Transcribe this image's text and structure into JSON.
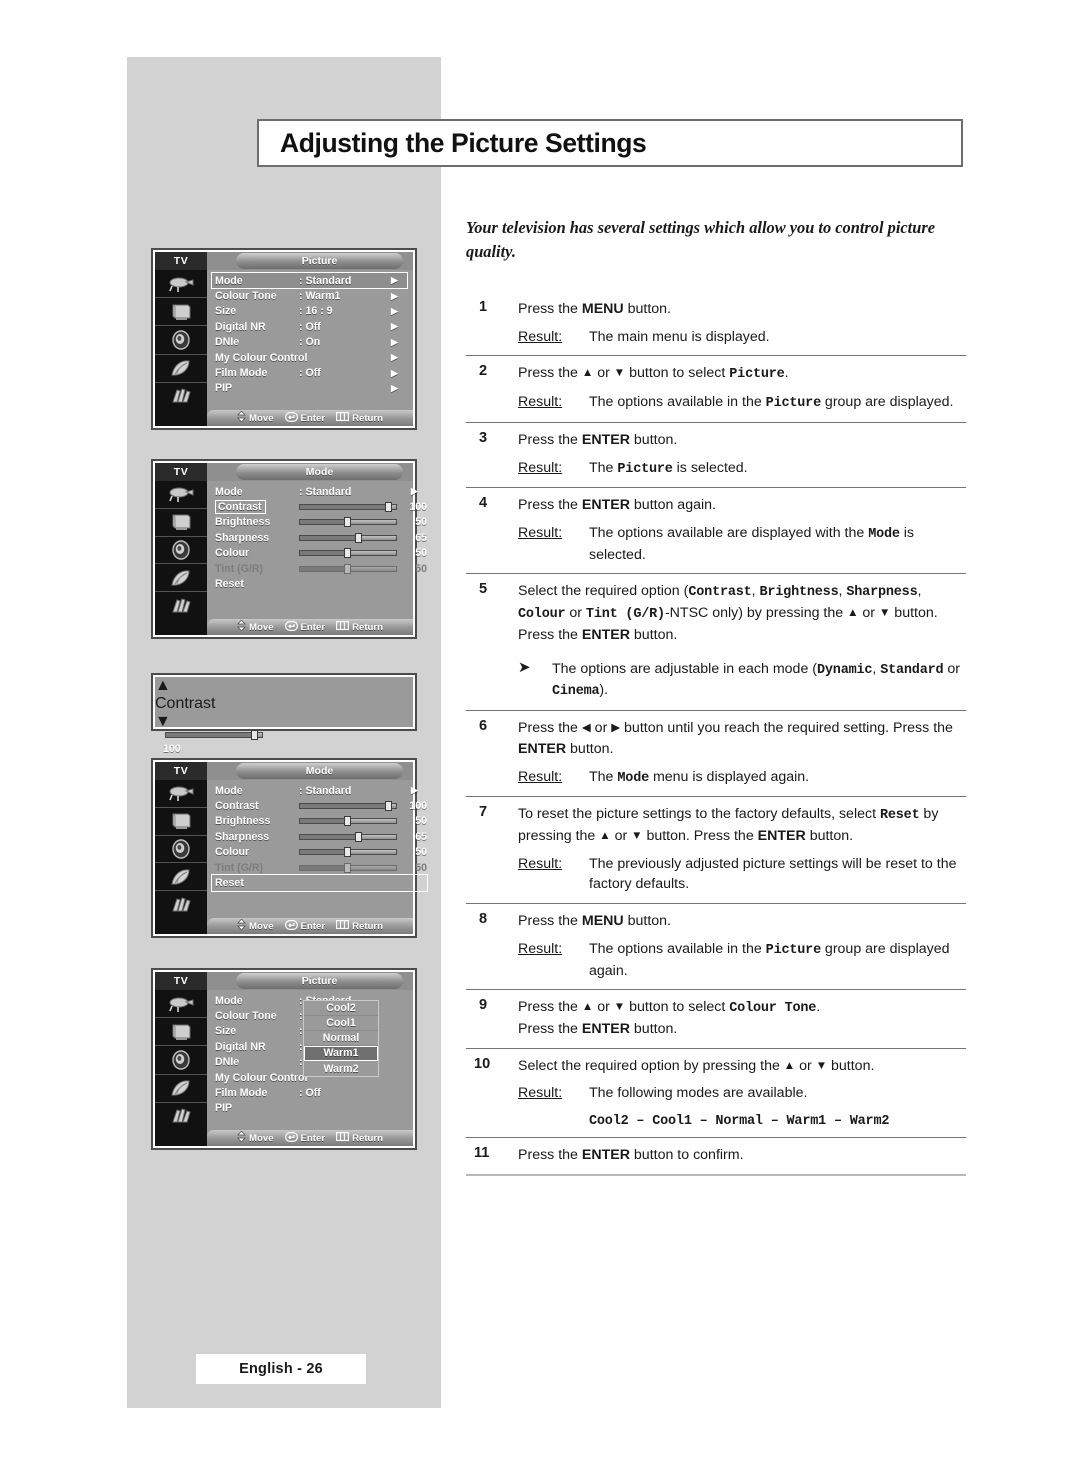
{
  "page": {
    "title": "Adjusting the Picture Settings",
    "intro": "Your television has several settings which allow you to control picture quality.",
    "footer": "English - 26"
  },
  "steps": [
    {
      "num": "1",
      "text_html": "Press the <b>MENU</b> button.",
      "result_label": "Result:",
      "result_html": "The main menu is displayed."
    },
    {
      "num": "2",
      "text_html": "Press the <span class=\"arrw\">▲</span> or <span class=\"arrw\">▼</span> button to select <span class=\"mono\">Picture</span>.",
      "result_label": "Result:",
      "result_html": "The options available in the <span class=\"mono\">Picture</span> group are displayed."
    },
    {
      "num": "3",
      "text_html": "Press the <b>ENTER</b> button.",
      "result_label": "Result:",
      "result_html": "The <span class=\"mono\">Picture</span> is selected."
    },
    {
      "num": "4",
      "text_html": "Press the <b>ENTER</b> button again.",
      "result_label": "Result:",
      "result_html": "The options available are displayed with the <span class=\"mono\">Mode</span> is selected."
    },
    {
      "num": "5",
      "text_html": "Select the required option (<span class=\"mono\">Contrast</span>, <span class=\"mono\">Brightness</span>, <span class=\"mono\">Sharpness</span>, <span class=\"mono\">Colour</span> or <span class=\"mono\">Tint&nbsp;(G/R)</span>-NTSC only) by pressing the <span class=\"arrw\">▲</span> or <span class=\"arrw\">▼</span> button.&nbsp; Press the <b>ENTER</b> button.",
      "bullet_html": "The options are adjustable in each mode (<span class=\"mono\">Dynamic</span>, <span class=\"mono\">Standard</span> or <span class=\"mono\">Cinema</span>)."
    },
    {
      "num": "6",
      "text_html": "Press the <span class=\"arrw\">◀</span> or <span class=\"arrw\">▶</span> button until you reach the required setting. Press the <b>ENTER</b> button.",
      "result_label": "Result:",
      "result_html": "The <span class=\"mono\">Mode</span> menu is displayed again."
    },
    {
      "num": "7",
      "text_html": "To reset the picture settings to the factory defaults, select <span class=\"mono\">Reset</span> by pressing the <span class=\"arrw\">▲</span> or <span class=\"arrw\">▼</span> button. Press the <b>ENTER</b> button.",
      "result_label": "Result:",
      "result_html": "The previously adjusted picture settings will be reset to the factory defaults."
    },
    {
      "num": "8",
      "text_html": "Press the <b>MENU</b> button.",
      "result_label": "Result:",
      "result_html": "The options available in the <span class=\"mono\">Picture</span> group are displayed again."
    },
    {
      "num": "9",
      "text_html": "Press the <span class=\"arrw\">▲</span> or <span class=\"arrw\">▼</span> button to select <span class=\"mono\">Colour&nbsp;Tone</span>.<br>Press the <b>ENTER</b> button."
    },
    {
      "num": "10",
      "text_html": "Select the required option by pressing the <span class=\"arrw\">▲</span> or <span class=\"arrw\">▼</span> button.",
      "result_label": "Result:",
      "result_html": "The following modes are available.",
      "modes_html": "<span class=\"mono\">Cool2&nbsp;&ndash;&nbsp;Cool1&nbsp;&ndash;&nbsp;Normal&nbsp;&ndash;&nbsp;Warm1&nbsp;&ndash;&nbsp;Warm2</span>"
    },
    {
      "num": "11",
      "text_html": "Press the <b>ENTER</b> button to confirm."
    }
  ],
  "osd_common": {
    "tv_tag": "TV",
    "bottom_bar": [
      {
        "icon": "move-updown-icon",
        "label": "Move"
      },
      {
        "icon": "enter-key-icon",
        "label": "Enter"
      },
      {
        "icon": "return-menu-icon",
        "label": "Return"
      }
    ],
    "side_icons": [
      "antenna-icon",
      "tv-set-icon",
      "speaker-icon",
      "feather-icon",
      "hand-icon"
    ]
  },
  "osd_picture_1": {
    "title": "Picture",
    "rows": [
      {
        "label": "Mode",
        "value": ": Standard",
        "caret": "▶",
        "selected": true
      },
      {
        "label": "Colour Tone",
        "value": ": Warm1",
        "caret": "▶"
      },
      {
        "label": "Size",
        "value": ": 16 : 9",
        "caret": "▶"
      },
      {
        "label": "Digital NR",
        "value": ": Off",
        "caret": "▶"
      },
      {
        "label": "DNIe",
        "value": ": On",
        "caret": "▶"
      },
      {
        "label": "My Colour Control",
        "value": "",
        "caret": "▶"
      },
      {
        "label": "Film Mode",
        "value": ": Off",
        "caret": "▶"
      },
      {
        "label": "PIP",
        "value": "",
        "caret": "▶"
      }
    ]
  },
  "osd_mode_1": {
    "title": "Mode",
    "mode_row": {
      "label": "Mode",
      "value": ": Standard",
      "caret": "▶"
    },
    "sliders": [
      {
        "label": "Contrast",
        "value": "100",
        "pct": 96,
        "boxed_label": true
      },
      {
        "label": "Brightness",
        "value": "50",
        "pct": 50
      },
      {
        "label": "Sharpness",
        "value": "65",
        "pct": 62
      },
      {
        "label": "Colour",
        "value": "50",
        "pct": 50
      },
      {
        "label": "Tint (G/R)",
        "value": "50",
        "pct": 50,
        "dim": true
      }
    ],
    "reset_label": "Reset",
    "reset_selected": false
  },
  "osd_contrast_widget": {
    "label": "Contrast",
    "value": "100",
    "pct": 96,
    "up_arrow": "▲",
    "down_arrow": "▼"
  },
  "osd_mode_2": {
    "title": "Mode",
    "mode_row": {
      "label": "Mode",
      "value": ": Standard",
      "caret": "▶"
    },
    "sliders": [
      {
        "label": "Contrast",
        "value": "100",
        "pct": 96
      },
      {
        "label": "Brightness",
        "value": "50",
        "pct": 50
      },
      {
        "label": "Sharpness",
        "value": "65",
        "pct": 62
      },
      {
        "label": "Colour",
        "value": "50",
        "pct": 50
      },
      {
        "label": "Tint (G/R)",
        "value": "50",
        "pct": 50,
        "dim": true
      }
    ],
    "reset_label": "Reset",
    "reset_selected": true
  },
  "osd_picture_2": {
    "title": "Picture",
    "rows": [
      {
        "label": "Mode",
        "value": ": Standard"
      },
      {
        "label": "Colour Tone",
        "value": ":"
      },
      {
        "label": "Size",
        "value": ":"
      },
      {
        "label": "Digital NR",
        "value": ":"
      },
      {
        "label": "DNIe",
        "value": ":"
      },
      {
        "label": "My Colour Control",
        "value": ""
      },
      {
        "label": "Film Mode",
        "value": ": Off"
      },
      {
        "label": "PIP",
        "value": ""
      }
    ],
    "dropdown": {
      "items": [
        {
          "label": "Cool2",
          "selected": false
        },
        {
          "label": "Cool1",
          "selected": false
        },
        {
          "label": "Normal",
          "selected": false
        },
        {
          "label": "Warm1",
          "selected": true
        },
        {
          "label": "Warm2",
          "selected": false
        }
      ]
    }
  }
}
